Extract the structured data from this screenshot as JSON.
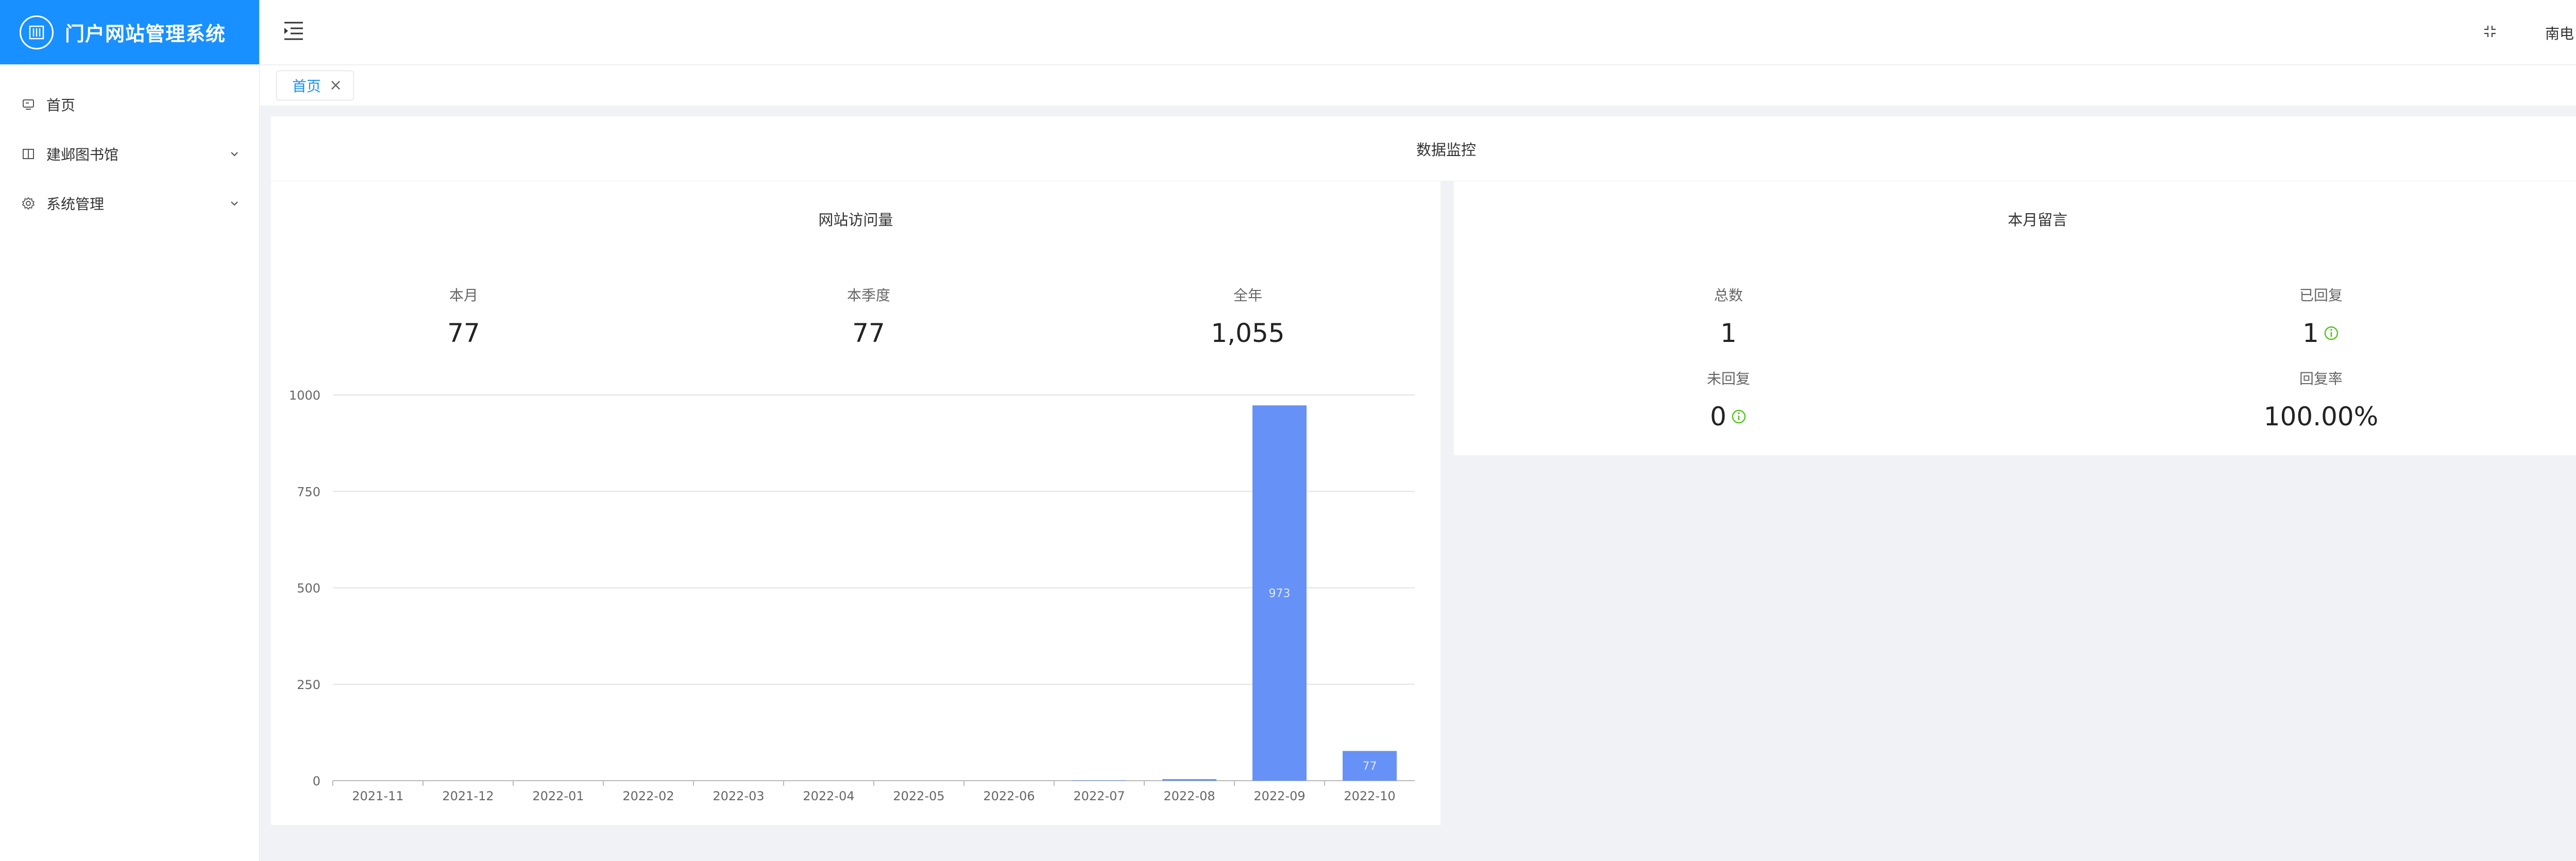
{
  "app": {
    "title": "门户网站管理系统"
  },
  "sidebar": {
    "items": [
      {
        "label": "首页",
        "icon": "monitor-icon"
      },
      {
        "label": "建邺图书馆",
        "icon": "book-icon"
      },
      {
        "label": "系统管理",
        "icon": "gear-icon"
      }
    ]
  },
  "header": {
    "user": "南电"
  },
  "tags": [
    {
      "label": "首页",
      "close": "×"
    }
  ],
  "monitor": {
    "title": "数据监控"
  },
  "visits": {
    "title": "网站访问量",
    "stats": [
      {
        "label": "本月",
        "value": "77"
      },
      {
        "label": "本季度",
        "value": "77"
      },
      {
        "label": "全年",
        "value": "1,055"
      }
    ]
  },
  "messages": {
    "title": "本月留言",
    "stats": [
      {
        "label": "总数",
        "value": "1"
      },
      {
        "label": "已回复",
        "value": "1"
      },
      {
        "label": "未回复",
        "value": "0"
      },
      {
        "label": "回复率",
        "value": "100.00%"
      }
    ]
  },
  "colors": {
    "primary": "#1890ff",
    "bar": "#6691f6",
    "info": "#52c41a"
  },
  "chart_data": {
    "type": "bar",
    "categories": [
      "2021-11",
      "2021-12",
      "2022-01",
      "2022-02",
      "2022-03",
      "2022-04",
      "2022-05",
      "2022-06",
      "2022-07",
      "2022-08",
      "2022-09",
      "2022-10"
    ],
    "values": [
      0,
      0,
      0,
      0,
      0,
      0,
      0,
      0,
      1,
      4,
      973,
      77
    ],
    "data_labels": {
      "2022-09": "973",
      "2022-10": "77"
    },
    "yticks": [
      "0",
      "250",
      "500",
      "750",
      "1000"
    ],
    "ylim": [
      0,
      1000
    ],
    "grid": true
  }
}
